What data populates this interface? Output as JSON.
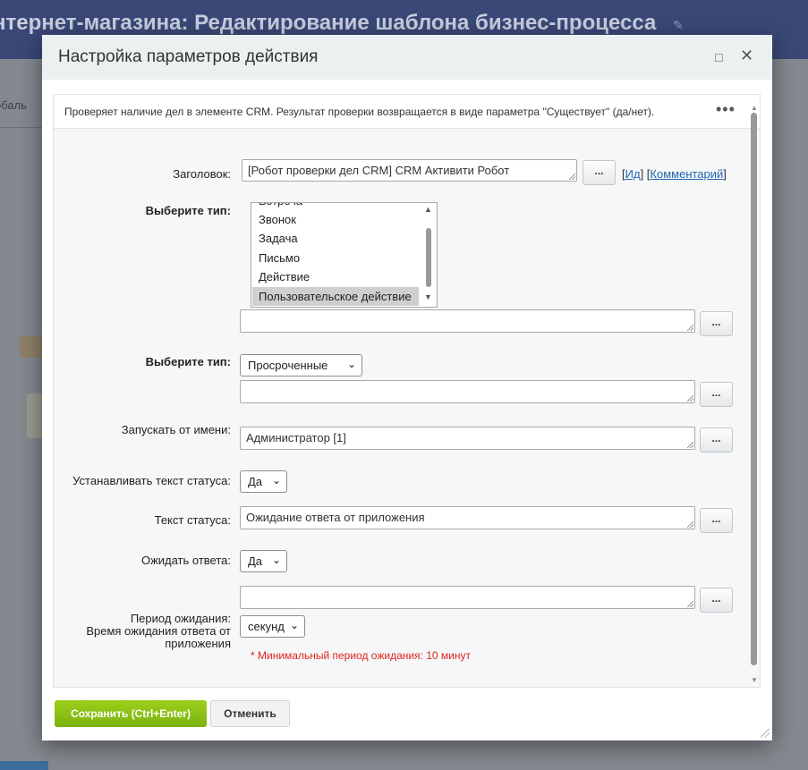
{
  "background": {
    "page_title": "нтернет-магазина: Редактирование шаблона бизнес-процесса",
    "side_text": "обаль"
  },
  "dialog": {
    "title": "Настройка параметров действия",
    "maximize_icon": "□",
    "close_icon": "✕",
    "description": "Проверяет наличие дел в элементе CRM. Результат проверки возвращается в виде параметра \"Существует\" (да/нет).",
    "more_icon": "•••"
  },
  "form": {
    "title_label": "Заголовок:",
    "title_value": "[Робот проверки дел CRM] CRM Активити Робот",
    "id_link": "Ид",
    "comment_link": "Комментарий",
    "type1_label": "Выберите тип:",
    "type1_options": [
      "Встреча",
      "Звонок",
      "Задача",
      "Письмо",
      "Действие",
      "Пользовательское действие"
    ],
    "type1_selected": "Пользовательское действие",
    "type2_label": "Выберите тип:",
    "type2_value": "Просроченные",
    "run_as_label": "Запускать от имени:",
    "run_as_value": "Администратор [1]",
    "set_status_label": "Устанавливать текст статуса:",
    "set_status_value": "Да",
    "status_text_label": "Текст статуса:",
    "status_text_value": "Ожидание ответа от приложения",
    "wait_label": "Ожидать ответа:",
    "wait_value": "Да",
    "period_label_1": "Период ожидания:",
    "period_label_2": "Время ожидания ответа от",
    "period_label_3": "приложения",
    "period_unit": "секунд",
    "min_period_warning": "* Минимальный период ожидания: 10 минут",
    "ellipsis": "..."
  },
  "buttons": {
    "save": "Сохранить (Ctrl+Enter)",
    "cancel": "Отменить"
  }
}
